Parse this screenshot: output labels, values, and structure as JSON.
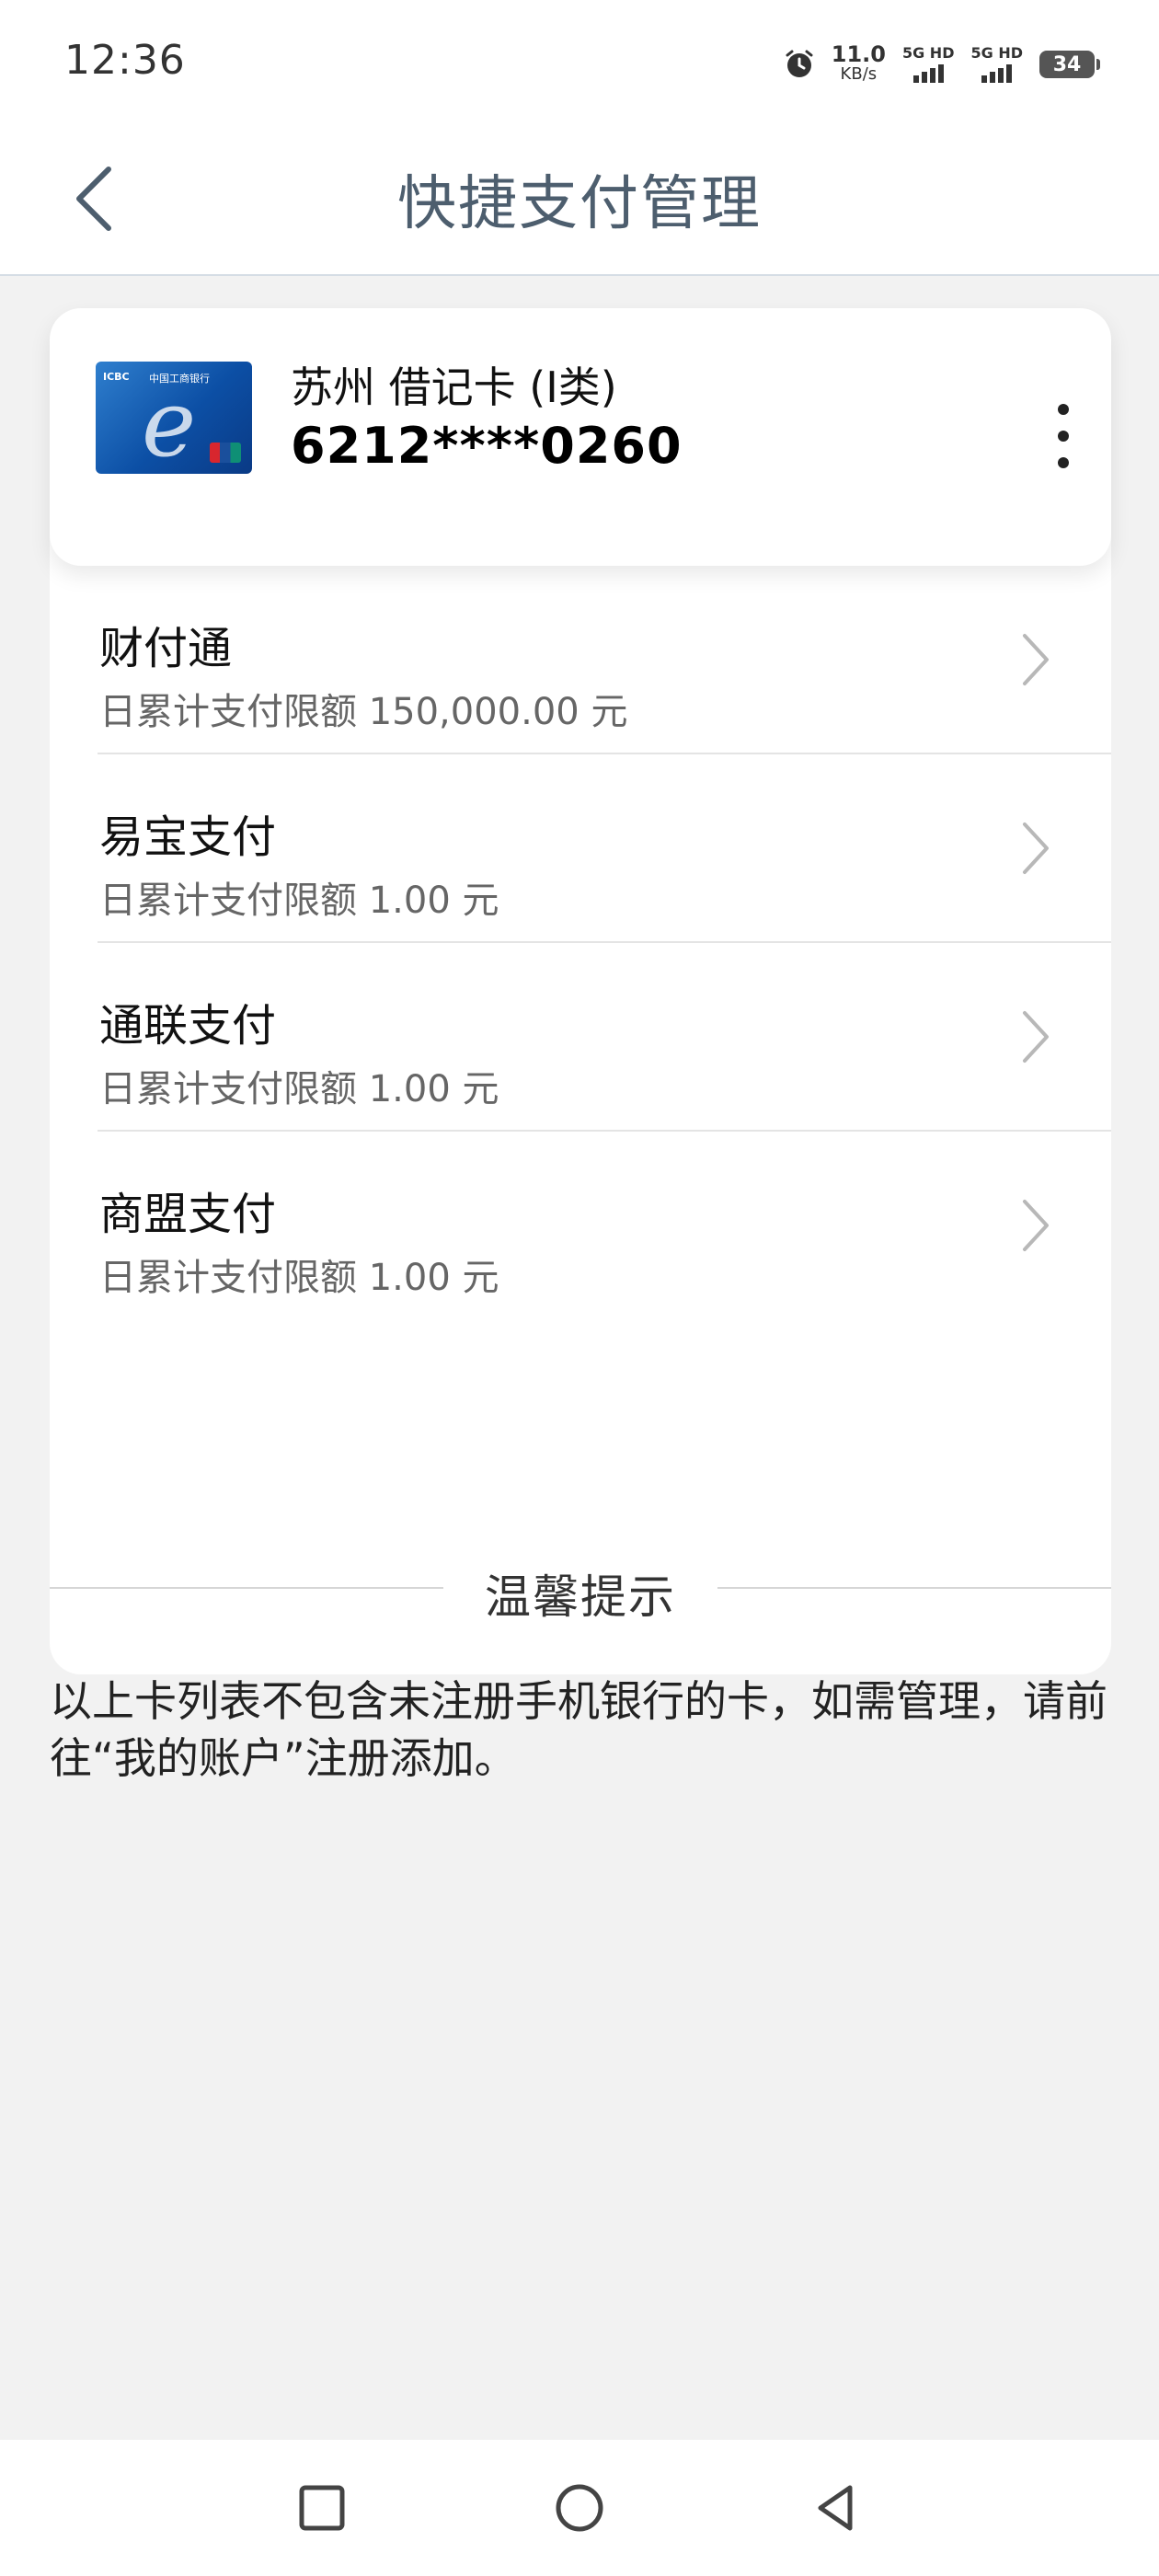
{
  "status_bar": {
    "time": "12:36",
    "speed_value": "11.0",
    "speed_unit": "KB/s",
    "sim1_label": "5G HD",
    "sim2_label": "5G HD",
    "battery": "34"
  },
  "header": {
    "title": "快捷支付管理"
  },
  "card": {
    "name": "苏州 借记卡 (I类)",
    "number": "6212****0260",
    "image_logo_text": "ICBC",
    "image_bank_text": "中国工商银行"
  },
  "payments": [
    {
      "name": "财付通",
      "limit": "日累计支付限额 150,000.00 元"
    },
    {
      "name": "易宝支付",
      "limit": "日累计支付限额 1.00 元"
    },
    {
      "name": "通联支付",
      "limit": "日累计支付限额 1.00 元"
    },
    {
      "name": "商盟支付",
      "limit": "日累计支付限额 1.00 元"
    }
  ],
  "tip": {
    "title": "温馨提示",
    "text": "以上卡列表不包含未注册手机银行的卡，如需管理，请前往“我的账户”注册添加。"
  },
  "icons": {
    "back": "chevron-left-icon",
    "more": "more-vertical-icon",
    "item_arrow": "chevron-right-icon",
    "nav_recent": "square-icon",
    "nav_home": "circle-icon",
    "nav_back": "triangle-back-icon"
  },
  "colors": {
    "title": "#4d5e6e",
    "background": "#f2f2f2",
    "card": "#ffffff"
  }
}
